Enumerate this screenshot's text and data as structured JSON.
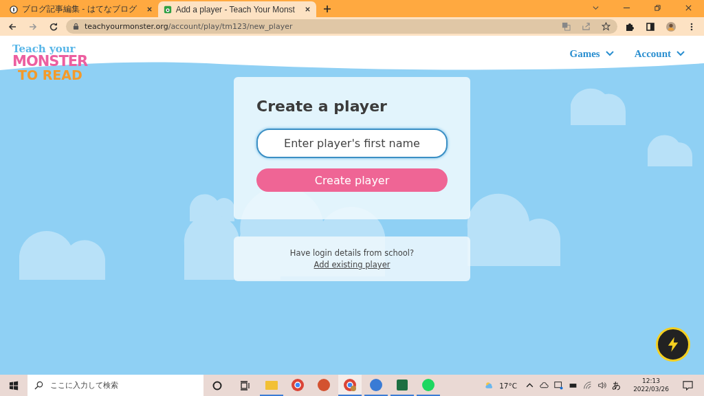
{
  "browser": {
    "tabs": [
      {
        "title": "ブログ記事編集 - はてなブログ",
        "selected": false
      },
      {
        "title": "Add a player - Teach Your Monst",
        "selected": true
      }
    ],
    "url": {
      "host": "teachyourmonster.org",
      "path": "/account/play/tm123/new_player"
    }
  },
  "header": {
    "logo": {
      "line1": "Teach your",
      "line2": "MONSTER",
      "line3": "TO READ"
    },
    "nav": [
      {
        "label": "Games"
      },
      {
        "label": "Account"
      }
    ]
  },
  "card": {
    "title": "Create a player",
    "placeholder": "Enter player's first name",
    "button": "Create player"
  },
  "school": {
    "question": "Have login details from school?",
    "link": "Add existing player"
  },
  "taskbar": {
    "search_placeholder": "ここに入力して検索",
    "apps": [
      {
        "kind": "folder",
        "running": true,
        "selected": false
      },
      {
        "kind": "chrome",
        "running": false,
        "selected": false
      },
      {
        "kind": "powerpoint",
        "running": false,
        "selected": false
      },
      {
        "kind": "chrome-profile",
        "running": true,
        "selected": true
      },
      {
        "kind": "thunderbird",
        "running": true,
        "selected": false
      },
      {
        "kind": "excel",
        "running": true,
        "selected": false
      },
      {
        "kind": "spotify",
        "running": true,
        "selected": false
      }
    ],
    "temperature": "17°C",
    "ime": "あ",
    "time": "12:13",
    "date": "2022/03/26"
  }
}
